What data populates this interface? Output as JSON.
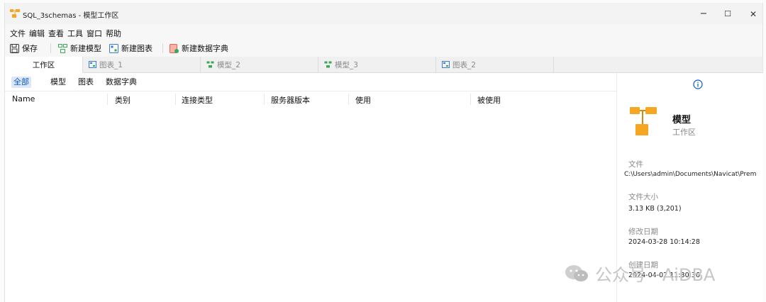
{
  "window": {
    "title": "SQL_3schemas - 模型工作区",
    "minimize": "−",
    "maximize": "☐",
    "close": "✕"
  },
  "menu": [
    "文件",
    "编辑",
    "查看",
    "工具",
    "窗口",
    "帮助"
  ],
  "toolbar": {
    "save": "保存",
    "new_model": "新建模型",
    "new_diagram": "新建图表",
    "new_dictionary": "新建数据字典"
  },
  "tabs": {
    "workspace": "工作区",
    "diagram_1": "图表_1",
    "model_2": "模型_2",
    "model_3": "模型_3",
    "diagram_2": "图表_2"
  },
  "filters": [
    "全部",
    "模型",
    "图表",
    "数据字典"
  ],
  "columns": [
    "Name",
    "类别",
    "连接类型",
    "服务器版本",
    "使用",
    "被使用"
  ],
  "info": {
    "icon": "info-icon",
    "title": "模型",
    "subtitle": "工作区",
    "file_label": "文件",
    "file_value": "C:\\Users\\admin\\Documents\\Navicat\\Prem",
    "size_label": "文件大小",
    "size_value": "3.13 KB (3,201)",
    "modified_label": "修改日期",
    "modified_value": "2024-03-28 10:14:28",
    "created_label": "创建日期",
    "created_value": "2024-04-02 11:30:36"
  },
  "watermark": {
    "text": "公众号 · AiDBA"
  },
  "colors": {
    "accent": "#0a59c4",
    "selected_bg": "#dce8f8",
    "orange": "#f5a623",
    "green": "#3aa856"
  }
}
